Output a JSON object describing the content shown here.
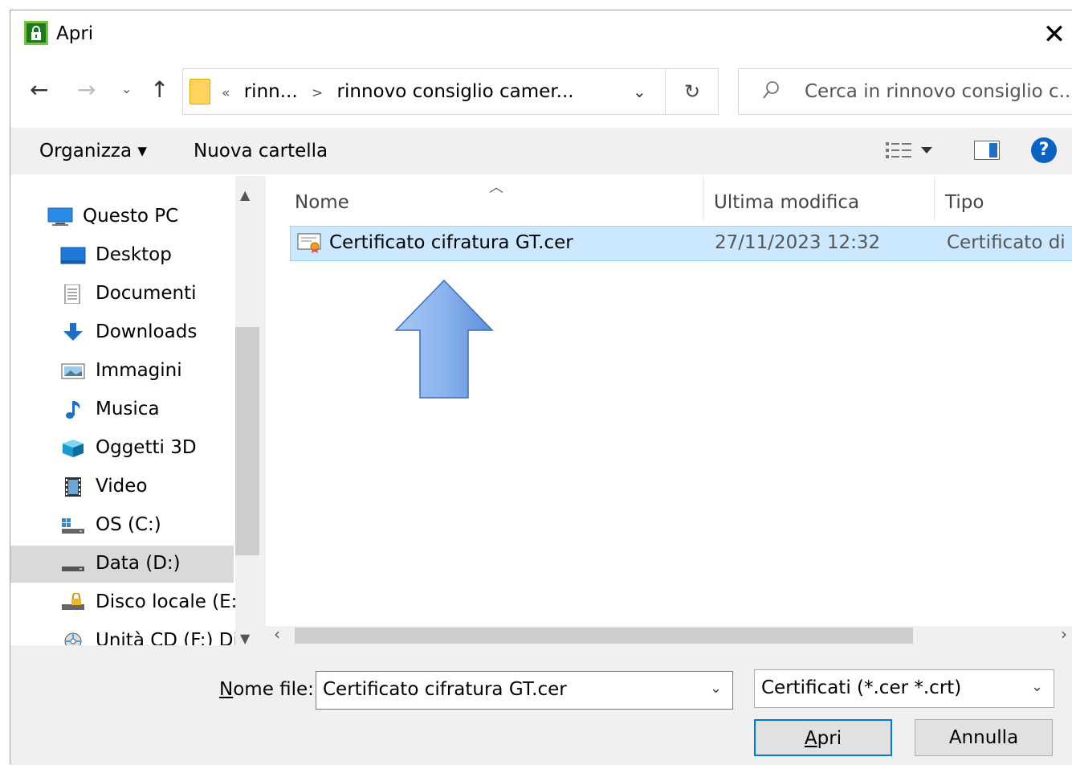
{
  "window": {
    "title": "Apri"
  },
  "address_bar": {
    "crumbs": [
      "«",
      "rinn...",
      ">",
      "rinnovo consiglio camer..."
    ]
  },
  "search": {
    "placeholder": "Cerca in rinnovo consiglio c..."
  },
  "toolbar": {
    "organize": "Organizza ▾",
    "new_folder": "Nuova cartella"
  },
  "nav_pane": {
    "items": [
      {
        "label": "Questo PC",
        "icon": "computer-icon"
      },
      {
        "label": "Desktop",
        "icon": "desktop-icon"
      },
      {
        "label": "Documenti",
        "icon": "documents-icon"
      },
      {
        "label": "Downloads",
        "icon": "downloads-icon"
      },
      {
        "label": "Immagini",
        "icon": "pictures-icon"
      },
      {
        "label": "Musica",
        "icon": "music-icon"
      },
      {
        "label": "Oggetti 3D",
        "icon": "3d-objects-icon"
      },
      {
        "label": "Video",
        "icon": "video-icon"
      },
      {
        "label": "OS (C:)",
        "icon": "windows-drive-icon"
      },
      {
        "label": "Data (D:)",
        "icon": "drive-icon",
        "selected": true
      },
      {
        "label": "Disco locale (E:)",
        "icon": "locked-drive-icon"
      },
      {
        "label": "Unità CD (F:) Dig",
        "icon": "cd-drive-icon"
      }
    ]
  },
  "file_list": {
    "columns": [
      "Nome",
      "Ultima modifica",
      "Tipo"
    ],
    "rows": [
      {
        "name": "Certificato cifratura GT.cer",
        "modified": "27/11/2023 12:32",
        "type": "Certificato di si",
        "icon": "certificate-icon",
        "selected": true
      }
    ]
  },
  "bottom": {
    "filename_label_underlined": "N",
    "filename_label_rest": "ome file:",
    "filename_value": "Certificato cifratura GT.cer",
    "filetype_value": "Certificati (*.cer *.crt)",
    "open_underlined": "A",
    "open_rest": "pri",
    "cancel_label": "Annulla"
  },
  "colors": {
    "selection": "#cce8ff",
    "selection_border": "#99d1ff",
    "accent": "#0078d7"
  }
}
